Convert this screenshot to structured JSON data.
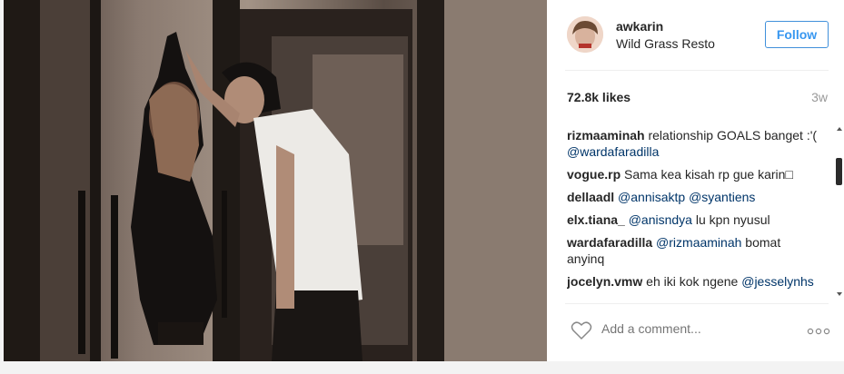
{
  "post": {
    "username": "awkarin",
    "location": "Wild Grass Resto",
    "follow_label": "Follow",
    "likes": "72.8k likes",
    "time_ago": "3w",
    "add_comment_placeholder": "Add a comment...",
    "more_label": "ooo"
  },
  "comments": [
    {
      "user": "rizmaaminah",
      "text": "relationship GOALS banget :'(",
      "mention": "@wardafaradilla",
      "after": ""
    },
    {
      "user": "vogue.rp",
      "text": "Sama kea kisah rp gue karin□",
      "mention": "",
      "after": ""
    },
    {
      "user": "dellaadl",
      "text": "",
      "mention": "@annisaktp @syantiens",
      "after": ""
    },
    {
      "user": "elx.tiana_",
      "text": "",
      "mention": "@anisndya",
      "after": "lu kpn nyusul"
    },
    {
      "user": "wardafaradilla",
      "text": "",
      "mention": "@rizmaaminah",
      "after": "bomat anyinq"
    },
    {
      "user": "jocelyn.vmw",
      "text": "eh iki kok ngene",
      "mention": "@jesselynhs",
      "after": ""
    }
  ],
  "colors": {
    "accent": "#3897f0",
    "mention": "#003569",
    "muted": "#999999"
  },
  "icons": {
    "heart": "heart-outline-icon",
    "more": "ellipsis-icon"
  }
}
